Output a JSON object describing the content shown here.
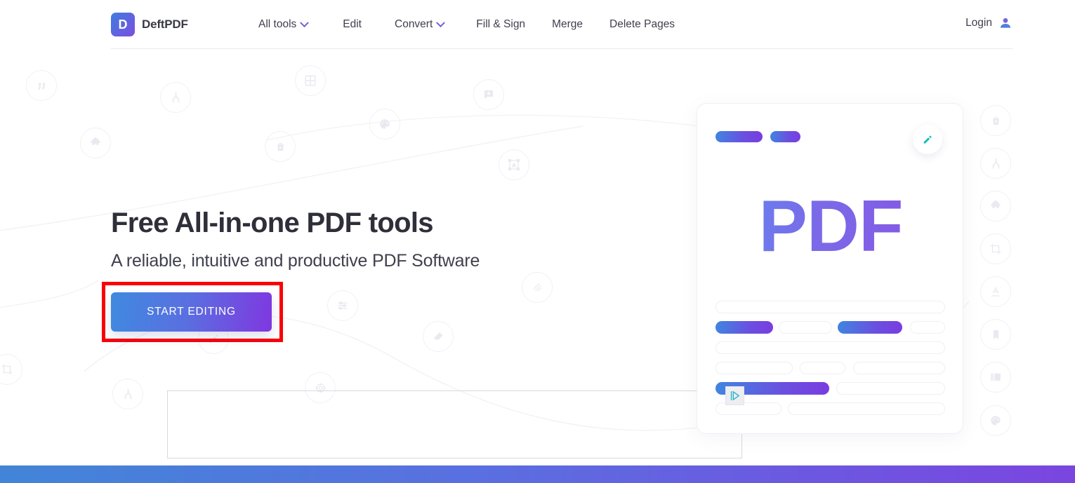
{
  "header": {
    "logo": {
      "letter": "D",
      "name": "DeftPDF",
      "gradient_from": "#3f7de0",
      "gradient_to": "#7b4ee0"
    },
    "nav": [
      {
        "label": "All tools",
        "has_chevron": true,
        "icon": "chevron-down-icon"
      },
      {
        "label": "Edit",
        "has_chevron": false
      },
      {
        "label": "Convert",
        "has_chevron": true,
        "icon": "chevron-down-icon"
      },
      {
        "label": "Fill & Sign",
        "has_chevron": false
      },
      {
        "label": "Merge",
        "has_chevron": false
      },
      {
        "label": "Delete Pages",
        "has_chevron": false
      }
    ],
    "login": {
      "label": "Login",
      "icon": "user-account-icon",
      "icon_color": "#6a5ce0"
    }
  },
  "hero": {
    "title": "Free All-in-one PDF tools",
    "subtitle": "A reliable, intuitive and productive PDF Software",
    "cta_label": "START EDITING",
    "cta_gradient_from": "#3f8ae0",
    "cta_gradient_to": "#8037e0"
  },
  "annotation": {
    "type": "highlight-rectangle",
    "color": "#fb0007",
    "target": "START EDITING"
  },
  "illustration": {
    "card_word": "PDF",
    "pencil_icon": "pencil-edit-icon",
    "pencil_color": "#17bdbd",
    "cursor_icon": "play-cursor-icon",
    "cursor_color": "#2bb6c9",
    "accent_from": "#3f86e0",
    "accent_to": "#7a3ce0"
  },
  "decorations": {
    "left_icons": [
      "quote-icon",
      "merge-icon",
      "grid-icon",
      "puzzle-icon",
      "delete-icon",
      "palette-icon",
      "comment-add-icon",
      "text-box-icon",
      "watermark-icon",
      "sliders-icon",
      "eraser-icon",
      "crop-icon",
      "target-icon",
      "merge-icon"
    ],
    "right_icons": [
      "delete-icon",
      "merge-icon",
      "puzzle-icon",
      "crop-icon",
      "text-underline-icon",
      "bookmark-icon",
      "image-icon",
      "palette-icon"
    ]
  },
  "footer": {
    "bar_gradient_from": "#4285d8",
    "bar_gradient_to": "#7b45e0"
  }
}
